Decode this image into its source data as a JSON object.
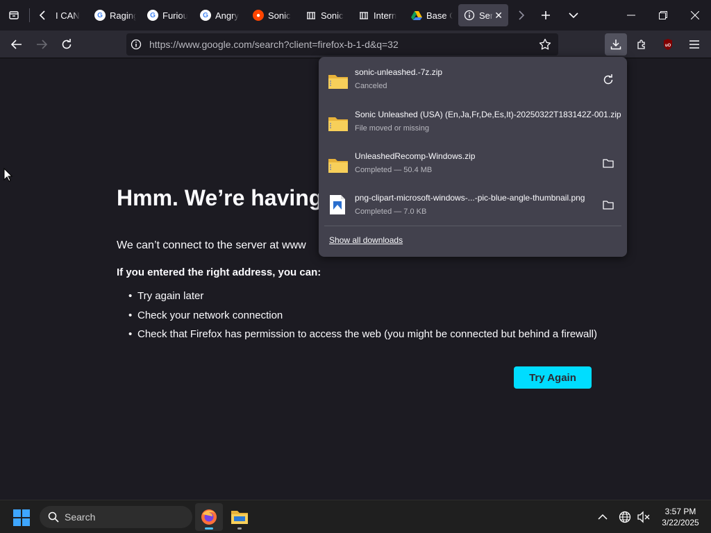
{
  "tabs": [
    {
      "label": "I CAN",
      "favicon": "none"
    },
    {
      "label": "Raging",
      "favicon": "google-icon"
    },
    {
      "label": "Furious",
      "favicon": "google-icon"
    },
    {
      "label": "Angry",
      "favicon": "google-icon"
    },
    {
      "label": "Sonic",
      "favicon": "reddit-icon"
    },
    {
      "label": "Sonic",
      "favicon": "archive-icon"
    },
    {
      "label": "Intern",
      "favicon": "archive-icon"
    },
    {
      "label": "Base G",
      "favicon": "drive-icon"
    },
    {
      "label": "Ser",
      "favicon": "info-icon",
      "active": true
    }
  ],
  "navbar": {
    "url": "https://www.google.com/search?client=firefox-b-1-d&q=32"
  },
  "error_page": {
    "title": "Hmm. We’re having",
    "description": "We can’t connect to the server at www",
    "subtitle": "If you entered the right address, you can:",
    "suggestions": [
      "Try again later",
      "Check your network connection",
      "Check that Firefox has permission to access the web (you might be connected but behind a firewall)"
    ],
    "try_again": "Try Again"
  },
  "downloads": {
    "items": [
      {
        "name": "sonic-unleashed.-7z.zip",
        "status": "Canceled",
        "icon": "zip-folder-icon",
        "action": "retry-icon"
      },
      {
        "name": "Sonic Unleashed (USA) (En,Ja,Fr,De,Es,It)-20250322T183142Z-001.zip",
        "status": "File moved or missing",
        "icon": "zip-folder-icon",
        "action": "none"
      },
      {
        "name": "UnleashedRecomp-Windows.zip",
        "status": "Completed — 50.4 MB",
        "icon": "zip-folder-icon",
        "action": "folder-icon"
      },
      {
        "name": "png-clipart-microsoft-windows-...-pic-blue-angle-thumbnail.png",
        "status": "Completed — 7.0 KB",
        "icon": "image-file-icon",
        "action": "folder-icon"
      }
    ],
    "show_all": "Show all downloads"
  },
  "taskbar": {
    "search_label": "Search",
    "time": "3:57 PM",
    "date": "3/22/2025"
  },
  "colors": {
    "accent": "#00ddff",
    "page_bg": "#1c1b22",
    "panel_bg": "#42414d"
  }
}
